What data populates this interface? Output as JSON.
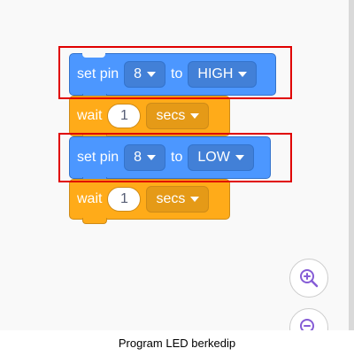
{
  "blocks": [
    {
      "keyword": "set pin",
      "pin": "8",
      "connector": "to",
      "state": "HIGH"
    },
    {
      "keyword": "wait",
      "amount": "1",
      "unit": "secs"
    },
    {
      "keyword": "set pin",
      "pin": "8",
      "connector": "to",
      "state": "LOW"
    },
    {
      "keyword": "wait",
      "amount": "1",
      "unit": "secs"
    }
  ],
  "colors": {
    "motion_block": "#4c97ff",
    "control_block": "#ffab19",
    "highlight": "#e00000"
  },
  "icons": {
    "zoom_in": "zoom-in-icon",
    "zoom_out": "zoom-out-icon"
  },
  "caption": "Program LED berkedip"
}
